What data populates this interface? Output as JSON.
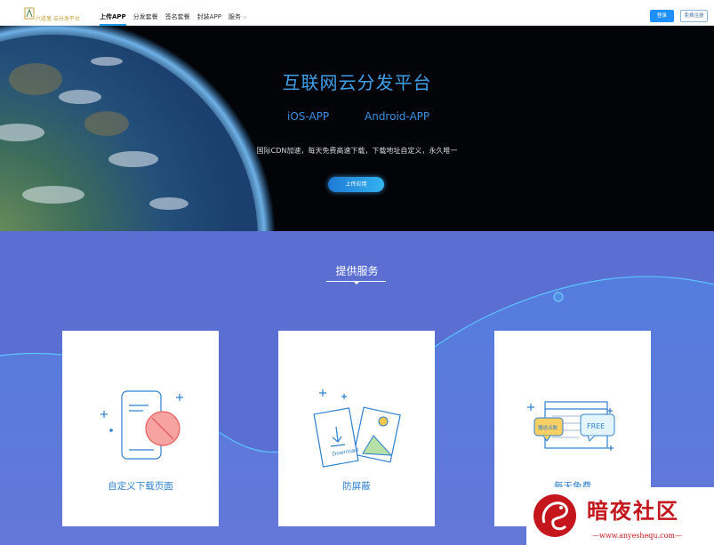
{
  "header": {
    "logo_text": "六道鬼  云分发平台",
    "nav": [
      {
        "label": "上传APP",
        "active": true
      },
      {
        "label": "分发套餐",
        "active": false
      },
      {
        "label": "签名套餐",
        "active": false
      },
      {
        "label": "封装APP",
        "active": false
      },
      {
        "label": "服务",
        "active": false
      }
    ],
    "login_label": "登录",
    "register_label": "免费注册"
  },
  "hero": {
    "title": "互联网云分发平台",
    "ios_label": "iOS-APP",
    "android_label": "Android-APP",
    "description": "国际CDN加速，每天免费高速下载，下载地址自定义，永久唯一",
    "upload_button": "上传应用"
  },
  "services": {
    "title": "提供服务",
    "cards": [
      {
        "label": "自定义下载页面",
        "icon": "custom-page-icon"
      },
      {
        "label": "防屏蔽",
        "icon": "anti-block-icon"
      },
      {
        "label": "每天免费",
        "icon": "daily-free-icon"
      }
    ],
    "icon_texts": {
      "download": "Download",
      "free": "FREE",
      "bonus": "赠送点数"
    }
  },
  "watermark": {
    "text": "暗夜社区",
    "url": "—www.anyeshequ.com—"
  },
  "colors": {
    "accent": "#1e90ff",
    "hero_title": "#3fa0ea",
    "services_bg": "#5b6fd3",
    "card_label": "#2d7fd0",
    "watermark": "#c4161c"
  }
}
